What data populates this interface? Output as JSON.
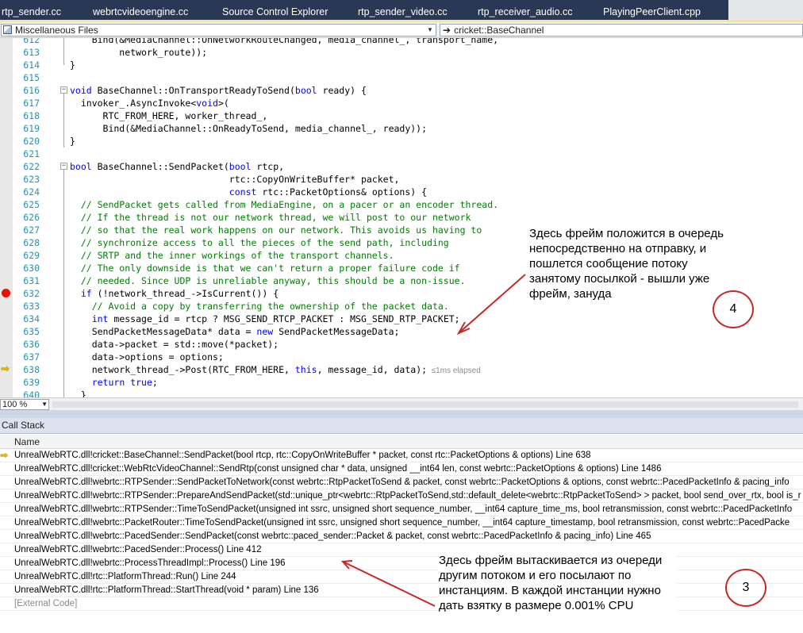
{
  "tabs": [
    {
      "label": "rtp_sender.cc"
    },
    {
      "label": "webrtcvideoengine.cc"
    },
    {
      "label": "Source Control Explorer"
    },
    {
      "label": "rtp_sender_video.cc"
    },
    {
      "label": "rtp_receiver_audio.cc"
    },
    {
      "label": "PlayingPeerClient.cpp"
    }
  ],
  "nav": {
    "scope": "Miscellaneous Files",
    "member_arrow": "➔",
    "member": "cricket::BaseChannel"
  },
  "editor": {
    "lines": [
      {
        "no": "612",
        "segments": [
          {
            "t": "    Bind(&MediaChannel::OnNetworkRouteChanged, media_channel_, transport_name,"
          }
        ]
      },
      {
        "no": "613",
        "segments": [
          {
            "t": "         network_route));"
          }
        ]
      },
      {
        "no": "614",
        "segments": [
          {
            "t": "}"
          }
        ]
      },
      {
        "no": "615",
        "segments": []
      },
      {
        "no": "616",
        "segments": [
          {
            "t": "void",
            "c": "kw"
          },
          {
            "t": " BaseChannel::OnTransportReadyToSend("
          },
          {
            "t": "bool",
            "c": "kw"
          },
          {
            "t": " ready) {"
          }
        ]
      },
      {
        "no": "617",
        "segments": [
          {
            "t": "  invoker_.AsyncInvoke<"
          },
          {
            "t": "void",
            "c": "kw"
          },
          {
            "t": ">("
          }
        ]
      },
      {
        "no": "618",
        "segments": [
          {
            "t": "      RTC_FROM_HERE, worker_thread_,"
          }
        ]
      },
      {
        "no": "619",
        "segments": [
          {
            "t": "      Bind(&MediaChannel::OnReadyToSend, media_channel_, ready));"
          }
        ]
      },
      {
        "no": "620",
        "segments": [
          {
            "t": "}"
          }
        ]
      },
      {
        "no": "621",
        "segments": []
      },
      {
        "no": "622",
        "segments": [
          {
            "t": "bool",
            "c": "kw"
          },
          {
            "t": " BaseChannel::SendPacket("
          },
          {
            "t": "bool",
            "c": "kw"
          },
          {
            "t": " rtcp,"
          }
        ]
      },
      {
        "no": "623",
        "segments": [
          {
            "t": "                             rtc::CopyOnWriteBuffer* packet,"
          }
        ]
      },
      {
        "no": "624",
        "segments": [
          {
            "t": "                             "
          },
          {
            "t": "const",
            "c": "kw"
          },
          {
            "t": " rtc::PacketOptions& options) {"
          }
        ]
      },
      {
        "no": "625",
        "segments": [
          {
            "t": "  // SendPacket gets called from MediaEngine, on a pacer or an encoder thread.",
            "c": "cm"
          }
        ]
      },
      {
        "no": "626",
        "segments": [
          {
            "t": "  // If the thread is not our network thread, we will post to our network",
            "c": "cm"
          }
        ]
      },
      {
        "no": "627",
        "segments": [
          {
            "t": "  // so that the real work happens on our network. This avoids us having to",
            "c": "cm"
          }
        ]
      },
      {
        "no": "628",
        "segments": [
          {
            "t": "  // synchronize access to all the pieces of the send path, including",
            "c": "cm"
          }
        ]
      },
      {
        "no": "629",
        "segments": [
          {
            "t": "  // SRTP and the inner workings of the transport channels.",
            "c": "cm"
          }
        ]
      },
      {
        "no": "630",
        "segments": [
          {
            "t": "  // The only downside is that we can't return a proper failure code if",
            "c": "cm"
          }
        ]
      },
      {
        "no": "631",
        "segments": [
          {
            "t": "  // needed. Since UDP is unreliable anyway, this should be a non-issue.",
            "c": "cm"
          }
        ]
      },
      {
        "no": "632",
        "segments": [
          {
            "t": "  "
          },
          {
            "t": "if",
            "c": "kw"
          },
          {
            "t": " (!network_thread_->IsCurrent()) {"
          }
        ]
      },
      {
        "no": "633",
        "segments": [
          {
            "t": "    // Avoid a copy by transferring the ownership of the packet data.",
            "c": "cm"
          }
        ]
      },
      {
        "no": "634",
        "segments": [
          {
            "t": "    "
          },
          {
            "t": "int",
            "c": "kw"
          },
          {
            "t": " message_id = rtcp ? MSG_SEND_RTCP_PACKET : MSG_SEND_RTP_PACKET;"
          }
        ]
      },
      {
        "no": "635",
        "segments": [
          {
            "t": "    SendPacketMessageData* data = "
          },
          {
            "t": "new",
            "c": "kw"
          },
          {
            "t": " SendPacketMessageData;"
          }
        ]
      },
      {
        "no": "636",
        "segments": [
          {
            "t": "    data->packet = std::move(*packet);"
          }
        ]
      },
      {
        "no": "637",
        "segments": [
          {
            "t": "    data->options = options;"
          }
        ]
      },
      {
        "no": "638",
        "segments": [
          {
            "t": "    network_thread_->Post(RTC_FROM_HERE, "
          },
          {
            "t": "this",
            "c": "kw"
          },
          {
            "t": ", message_id, data);"
          },
          {
            "t": "  ≤1ms elapsed",
            "c": "elapsed"
          }
        ]
      },
      {
        "no": "639",
        "segments": [
          {
            "t": "    "
          },
          {
            "t": "return",
            "c": "kw"
          },
          {
            "t": " "
          },
          {
            "t": "true",
            "c": "kw"
          },
          {
            "t": ";"
          }
        ]
      },
      {
        "no": "640",
        "segments": [
          {
            "t": "  }"
          }
        ]
      }
    ]
  },
  "zoom": {
    "value": "100 %"
  },
  "callstack": {
    "title": "Call Stack",
    "column_name": "Name",
    "frames": [
      "UnrealWebRTC.dll!cricket::BaseChannel::SendPacket(bool rtcp, rtc::CopyOnWriteBuffer * packet, const rtc::PacketOptions & options) Line 638",
      "UnrealWebRTC.dll!cricket::WebRtcVideoChannel::SendRtp(const unsigned char * data, unsigned __int64 len, const webrtc::PacketOptions & options) Line 1486",
      "UnrealWebRTC.dll!webrtc::RTPSender::SendPacketToNetwork(const webrtc::RtpPacketToSend & packet, const webrtc::PacketOptions & options, const webrtc::PacedPacketInfo & pacing_info",
      "UnrealWebRTC.dll!webrtc::RTPSender::PrepareAndSendPacket(std::unique_ptr<webrtc::RtpPacketToSend,std::default_delete<webrtc::RtpPacketToSend> > packet, bool send_over_rtx, bool is_r",
      "UnrealWebRTC.dll!webrtc::RTPSender::TimeToSendPacket(unsigned int ssrc, unsigned short sequence_number, __int64 capture_time_ms, bool retransmission, const webrtc::PacedPacketInfo",
      "UnrealWebRTC.dll!webrtc::PacketRouter::TimeToSendPacket(unsigned int ssrc, unsigned short sequence_number, __int64 capture_timestamp, bool retransmission, const webrtc::PacedPacke",
      "UnrealWebRTC.dll!webrtc::PacedSender::SendPacket(const webrtc::paced_sender::Packet & packet, const webrtc::PacedPacketInfo & pacing_info) Line 465",
      "UnrealWebRTC.dll!webrtc::PacedSender::Process() Line 412",
      "UnrealWebRTC.dll!webrtc::ProcessThreadImpl::Process() Line 196",
      "UnrealWebRTC.dll!rtc::PlatformThread::Run() Line 244",
      "UnrealWebRTC.dll!rtc::PlatformThread::StartThread(void * param) Line 136",
      "[External Code]"
    ]
  },
  "annotations": {
    "note4": "Здесь фрейм положится в очередь непосредственно на отправку, и пошлется сообщение потоку занятому посылкой - вышли уже фрейм, зануда",
    "circle4": "4",
    "note3": "Здесь фрейм вытаскивается из очереди другим потоком и его посылают по инстанциям. В каждой инстанции нужно дать взятку в размере 0.001% CPU",
    "circle3": "3",
    "color": "#c62828"
  }
}
